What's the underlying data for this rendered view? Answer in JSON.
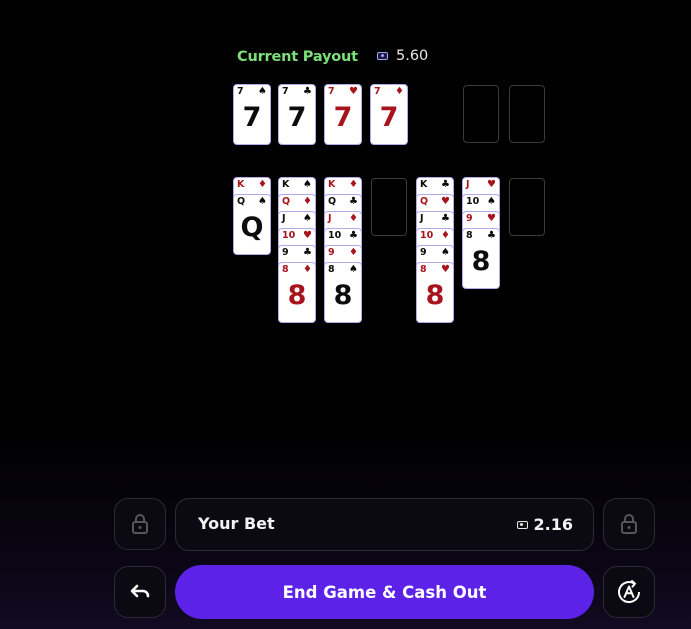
{
  "header": {
    "payout_label": "Current Payout",
    "payout_amount": "5.60",
    "currency_icon": "cash-icon"
  },
  "foundation": [
    {
      "rank": "7",
      "suit": "♠",
      "color": "black"
    },
    {
      "rank": "7",
      "suit": "♣",
      "color": "black"
    },
    {
      "rank": "7",
      "suit": "♥",
      "color": "red"
    },
    {
      "rank": "7",
      "suit": "♦",
      "color": "red"
    }
  ],
  "empty_top_slots": 2,
  "tableau": [
    [
      {
        "rank": "K",
        "suit": "♦",
        "color": "red"
      },
      {
        "rank": "Q",
        "suit": "♠",
        "color": "black"
      }
    ],
    [
      {
        "rank": "K",
        "suit": "♠",
        "color": "black"
      },
      {
        "rank": "Q",
        "suit": "♦",
        "color": "red"
      },
      {
        "rank": "J",
        "suit": "♠",
        "color": "black"
      },
      {
        "rank": "10",
        "suit": "♥",
        "color": "red"
      },
      {
        "rank": "9",
        "suit": "♣",
        "color": "black"
      },
      {
        "rank": "8",
        "suit": "♦",
        "color": "red"
      }
    ],
    [
      {
        "rank": "K",
        "suit": "♦",
        "color": "red"
      },
      {
        "rank": "Q",
        "suit": "♣",
        "color": "black"
      },
      {
        "rank": "J",
        "suit": "♦",
        "color": "red"
      },
      {
        "rank": "10",
        "suit": "♣",
        "color": "black"
      },
      {
        "rank": "9",
        "suit": "♦",
        "color": "red"
      },
      {
        "rank": "8",
        "suit": "♠",
        "color": "black"
      }
    ],
    [],
    [
      {
        "rank": "K",
        "suit": "♣",
        "color": "black"
      },
      {
        "rank": "Q",
        "suit": "♥",
        "color": "red"
      },
      {
        "rank": "J",
        "suit": "♣",
        "color": "black"
      },
      {
        "rank": "10",
        "suit": "♦",
        "color": "red"
      },
      {
        "rank": "9",
        "suit": "♠",
        "color": "black"
      },
      {
        "rank": "8",
        "suit": "♥",
        "color": "red"
      }
    ],
    [
      {
        "rank": "J",
        "suit": "♥",
        "color": "red"
      },
      {
        "rank": "10",
        "suit": "♠",
        "color": "black"
      },
      {
        "rank": "9",
        "suit": "♥",
        "color": "red"
      },
      {
        "rank": "8",
        "suit": "♣",
        "color": "black"
      }
    ],
    []
  ],
  "bet": {
    "label": "Your Bet",
    "amount": "2.16"
  },
  "actions": {
    "cashout_label": "End Game & Cash Out",
    "undo_icon": "undo-icon",
    "auto_icon": "auto-play-icon",
    "lock_icon": "lock-icon"
  },
  "colors": {
    "accent": "#5c22e8",
    "payout_label": "#7ee07a",
    "card_red": "#a7141d",
    "card_border": "#b5a9ec"
  }
}
